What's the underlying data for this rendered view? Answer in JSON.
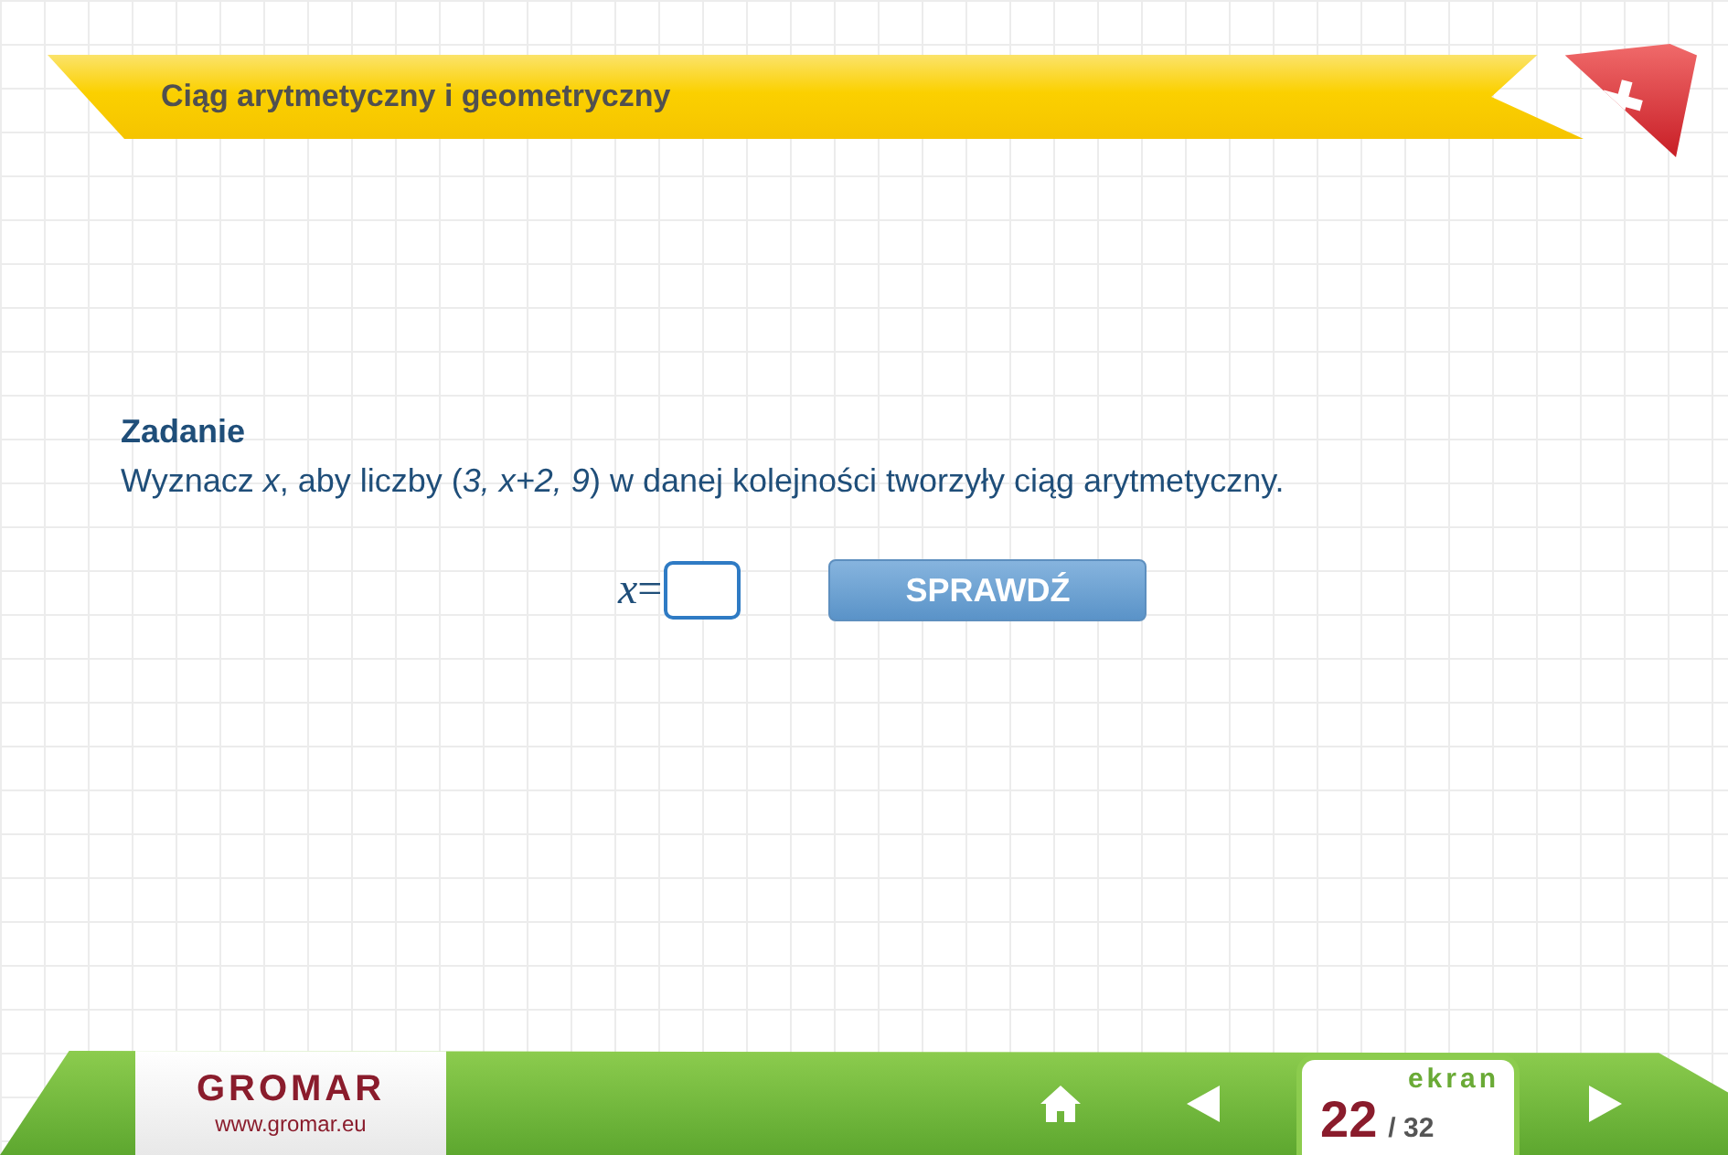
{
  "header": {
    "title": "Ciąg arytmetyczny i geometryczny"
  },
  "task": {
    "heading": "Zadanie",
    "text": "Wyznacz *x*, aby liczby (*3, x+2, 9*) w danej kolejności tworzyły ciąg arytmetyczny."
  },
  "answer": {
    "label": "*x*=",
    "button": "SPRAWDŹ"
  },
  "footer": {
    "logo": "GROMAR",
    "url": "www.gromar.eu",
    "screen_label": "ekran",
    "screen_current": "22",
    "screen_total": "/ 32"
  }
}
